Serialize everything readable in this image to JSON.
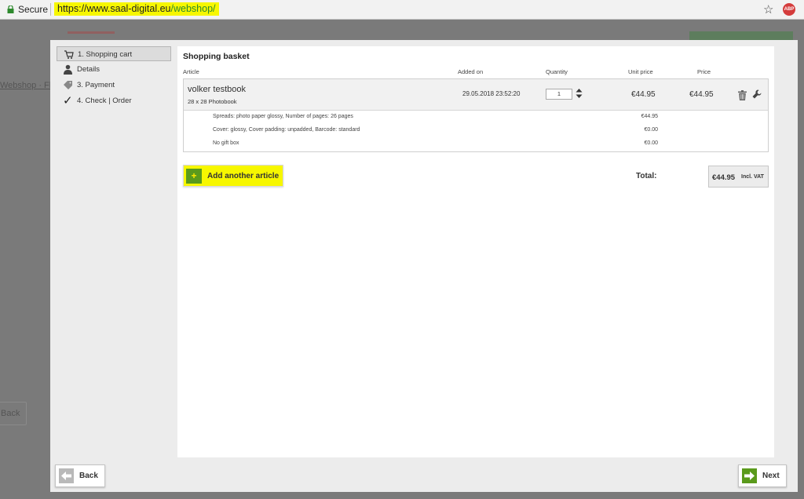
{
  "browser": {
    "secure_label": "Secure",
    "url_host": "https://www.saal-digital.eu",
    "url_path": "/webshop/",
    "abp_label": "ABP"
  },
  "background": {
    "breadcrumb": "Webshop · Fla",
    "back_label": "Back"
  },
  "steps": [
    {
      "label": "1. Shopping cart",
      "icon": "cart-icon",
      "active": true
    },
    {
      "label": "Details",
      "icon": "person-icon",
      "active": false
    },
    {
      "label": "3. Payment",
      "icon": "tag-icon",
      "active": false
    },
    {
      "label": "4. Check | Order",
      "icon": "check-icon",
      "active": false
    }
  ],
  "basket": {
    "title": "Shopping basket",
    "columns": {
      "article": "Article",
      "added_on": "Added on",
      "quantity": "Quantity",
      "unit_price": "Unit price",
      "price": "Price"
    },
    "item": {
      "name": "volker testbook",
      "subtitle": "28 x 28 Photobook",
      "added_on": "29.05.2018 23:52:20",
      "quantity": "1",
      "unit_price": "€44.95",
      "price": "€44.95",
      "details": [
        {
          "label": "Spreads: photo paper glossy, Number of pages: 26 pages",
          "price": "€44.95"
        },
        {
          "label": "Cover: glossy, Cover padding: unpadded, Barcode: standard",
          "price": "€0.00"
        },
        {
          "label": "No gift box",
          "price": "€0.00"
        }
      ]
    },
    "add_article_label": "Add another article",
    "total_label": "Total:",
    "total_value": "€44.95",
    "total_vat": "Incl. VAT"
  },
  "footer": {
    "back_label": "Back",
    "next_label": "Next"
  },
  "colors": {
    "highlight": "#f7f700",
    "green": "#5a9a1c"
  }
}
